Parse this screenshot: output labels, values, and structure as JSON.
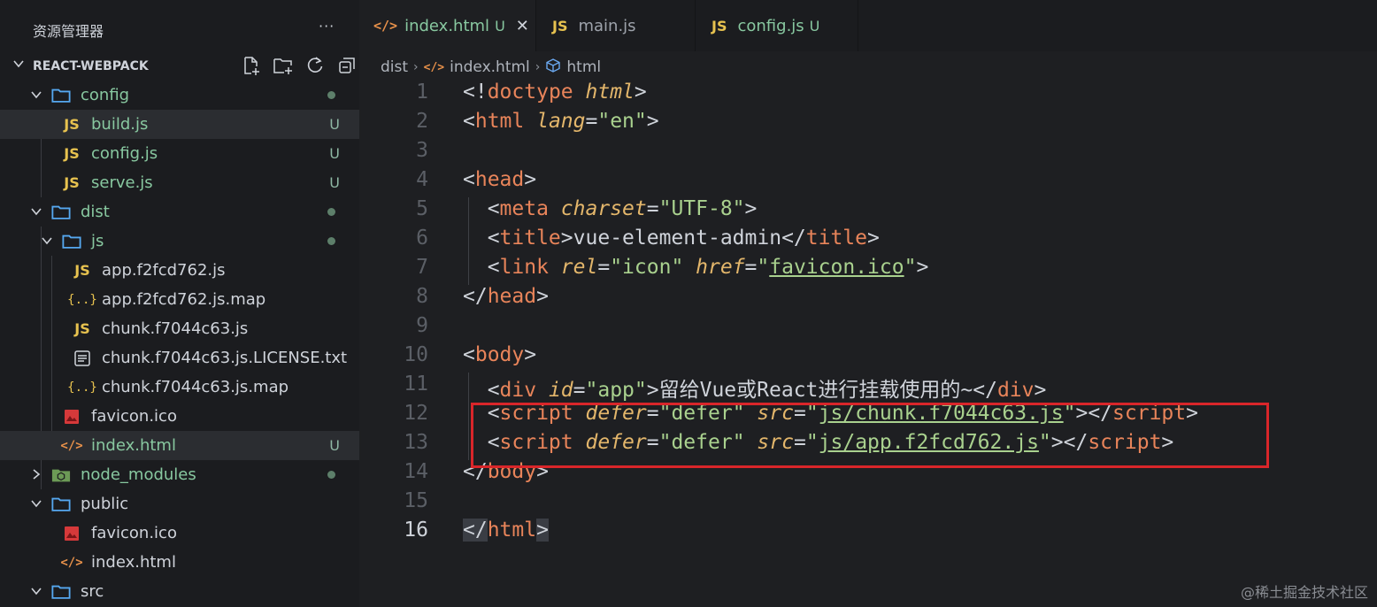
{
  "sidebar": {
    "title": "资源管理器",
    "more": "···",
    "project": "REACT-WEBPACK",
    "items": [
      {
        "label": "config",
        "type": "folder",
        "status": "dot"
      },
      {
        "label": "build.js",
        "type": "js",
        "status": "U"
      },
      {
        "label": "config.js",
        "type": "js",
        "status": "U"
      },
      {
        "label": "serve.js",
        "type": "js",
        "status": "U"
      },
      {
        "label": "dist",
        "type": "folder",
        "status": "dot"
      },
      {
        "label": "js",
        "type": "folder",
        "status": "dot"
      },
      {
        "label": "app.f2fcd762.js",
        "type": "js",
        "status": ""
      },
      {
        "label": "app.f2fcd762.js.map",
        "type": "map",
        "status": ""
      },
      {
        "label": "chunk.f7044c63.js",
        "type": "js",
        "status": ""
      },
      {
        "label": "chunk.f7044c63.js.LICENSE.txt",
        "type": "txt",
        "status": ""
      },
      {
        "label": "chunk.f7044c63.js.map",
        "type": "map",
        "status": ""
      },
      {
        "label": "favicon.ico",
        "type": "image",
        "status": ""
      },
      {
        "label": "index.html",
        "type": "html",
        "status": "U"
      },
      {
        "label": "node_modules",
        "type": "node",
        "status": "dot"
      },
      {
        "label": "public",
        "type": "folder",
        "status": ""
      },
      {
        "label": "favicon.ico",
        "type": "image",
        "status": ""
      },
      {
        "label": "index.html",
        "type": "html",
        "status": ""
      },
      {
        "label": "src",
        "type": "folder",
        "status": ""
      }
    ]
  },
  "tabs": [
    {
      "icon": "</>",
      "label": "index.html",
      "badge": "U",
      "close": "✕"
    },
    {
      "icon": "JS",
      "label": "main.js",
      "badge": ""
    },
    {
      "icon": "JS",
      "label": "config.js",
      "badge": "U"
    }
  ],
  "breadcrumb": [
    "dist",
    "index.html",
    "html"
  ],
  "code": {
    "line_numbers": [
      "1",
      "2",
      "3",
      "4",
      "5",
      "6",
      "7",
      "8",
      "9",
      "10",
      "11",
      "12",
      "13",
      "14",
      "15",
      "16"
    ],
    "current_line": "16",
    "l1": {
      "a": "<!",
      "b": "doctype",
      "c": " ",
      "d": "html",
      "e": ">"
    },
    "l2": {
      "a": "<",
      "b": "html",
      "c": " ",
      "d": "lang",
      "e": "=",
      "f": "\"en\"",
      "g": ">"
    },
    "l4": {
      "a": "<",
      "b": "head",
      "c": ">"
    },
    "l5": {
      "a": "  <",
      "b": "meta",
      "c": " ",
      "d": "charset",
      "e": "=",
      "f": "\"UTF-8\"",
      "g": ">"
    },
    "l6": {
      "a": "  <",
      "b": "title",
      "c": ">",
      "d": "vue-element-admin",
      "e": "</",
      "f": "title",
      "g": ">"
    },
    "l7": {
      "a": "  <",
      "b": "link",
      "c": " ",
      "d": "rel",
      "e": "=",
      "f": "\"icon\"",
      "g": " ",
      "h": "href",
      "i": "=",
      "j": "\"",
      "k": "favicon.ico",
      "l": "\"",
      "m": ">"
    },
    "l8": {
      "a": "</",
      "b": "head",
      "c": ">"
    },
    "l10": {
      "a": "<",
      "b": "body",
      "c": ">"
    },
    "l11": {
      "a": "  <",
      "b": "div",
      "c": " ",
      "d": "id",
      "e": "=",
      "f": "\"app\"",
      "g": ">留给Vue或React进行挂载使用的~</",
      "h": "div",
      "i": ">"
    },
    "l12": {
      "a": "  <",
      "b": "script",
      "c": " ",
      "d": "defer",
      "e": "=",
      "f": "\"defer\"",
      "g": " ",
      "h": "src",
      "i": "=",
      "j": "\"",
      "k": "js/chunk.f7044c63.js",
      "l": "\"",
      "m": "></",
      "n": "script",
      "o": ">"
    },
    "l13": {
      "a": "  <",
      "b": "script",
      "c": " ",
      "d": "defer",
      "e": "=",
      "f": "\"defer\"",
      "g": " ",
      "h": "src",
      "i": "=",
      "j": "\"",
      "k": "js/app.f2fcd762.js",
      "l": "\"",
      "m": "></",
      "n": "script",
      "o": ">"
    },
    "l14": {
      "a": "</",
      "b": "body",
      "c": ">"
    },
    "l16": {
      "a": "</",
      "b": "html",
      "c": ">"
    }
  },
  "watermark": "@稀土掘金技术社区",
  "colors": {
    "tag": "#e8845a",
    "attr": "#e3b66b",
    "string": "#a9d18e",
    "highlight": "#d9262a"
  }
}
